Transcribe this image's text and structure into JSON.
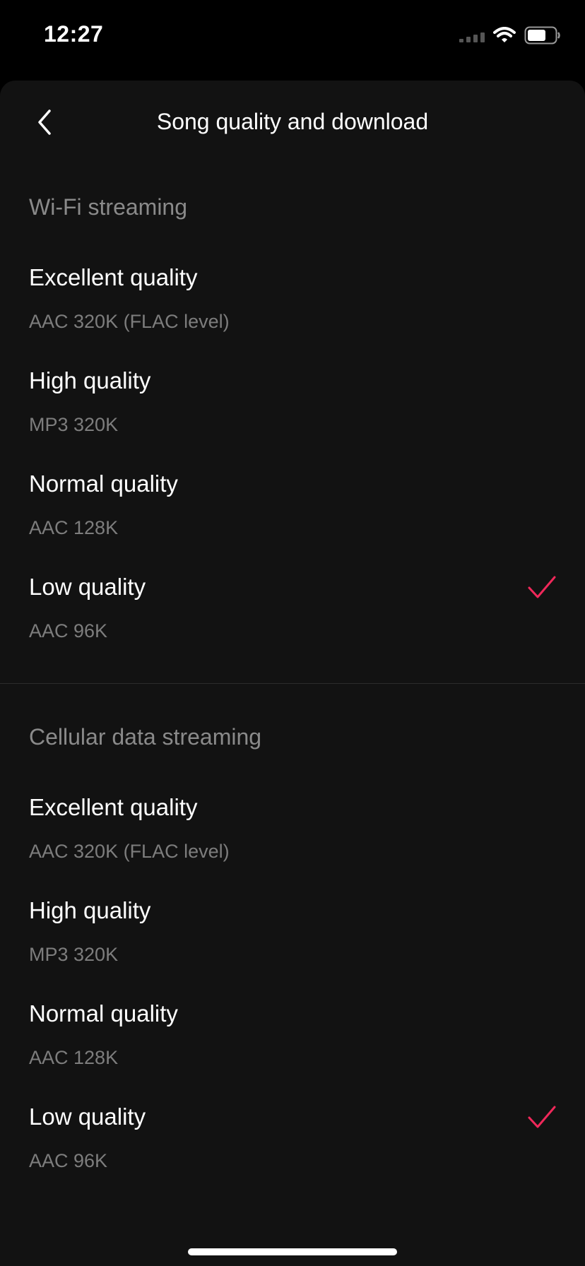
{
  "status_bar": {
    "time": "12:27"
  },
  "header": {
    "title": "Song quality and download"
  },
  "wifi": {
    "title": "Wi-Fi streaming",
    "options": [
      {
        "label": "Excellent quality",
        "detail": "AAC 320K (FLAC level)",
        "selected": false
      },
      {
        "label": "High quality",
        "detail": "MP3 320K",
        "selected": false
      },
      {
        "label": "Normal quality",
        "detail": "AAC 128K",
        "selected": false
      },
      {
        "label": "Low quality",
        "detail": "AAC 96K",
        "selected": true
      }
    ]
  },
  "cellular": {
    "title": "Cellular data streaming",
    "options": [
      {
        "label": "Excellent quality",
        "detail": "AAC 320K (FLAC level)",
        "selected": false
      },
      {
        "label": "High quality",
        "detail": "MP3 320K",
        "selected": false
      },
      {
        "label": "Normal quality",
        "detail": "AAC 128K",
        "selected": false
      },
      {
        "label": "Low quality",
        "detail": "AAC 96K",
        "selected": true
      }
    ]
  },
  "colors": {
    "accent": "#f0285a",
    "background": "#121212"
  },
  "icons": {
    "back": "chevron-left-icon",
    "selected": "checkmark-icon"
  }
}
